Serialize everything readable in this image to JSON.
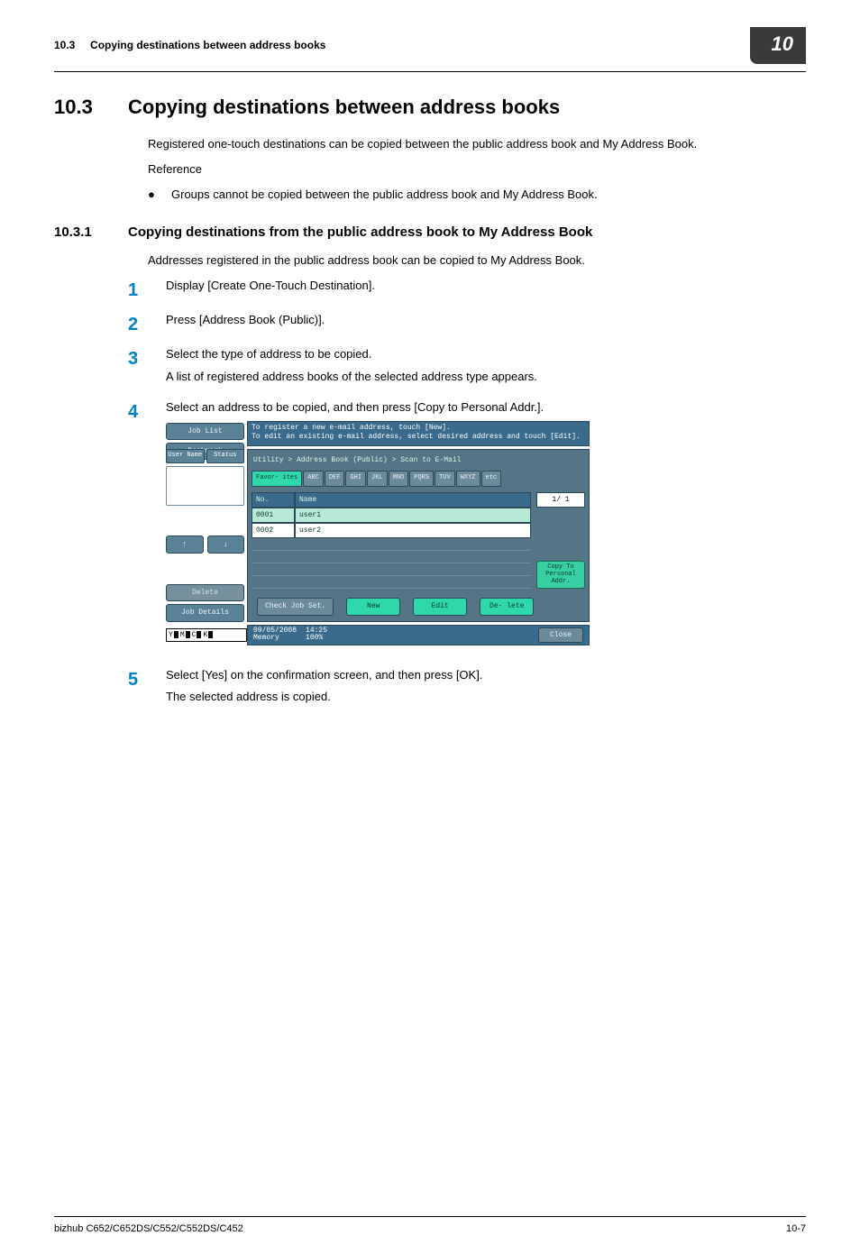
{
  "header": {
    "section_ref": "10.3",
    "running_title": "Copying destinations between address books",
    "chapter_badge": "10"
  },
  "section": {
    "number": "10.3",
    "title": "Copying destinations between address books",
    "intro": "Registered one-touch destinations can be copied between the public address book and My Address Book.",
    "ref_label": "Reference",
    "bullet": "Groups cannot be copied between the public address book and My Address Book."
  },
  "subsection": {
    "number": "10.3.1",
    "title": "Copying destinations from the public address book to My Address Book",
    "intro": "Addresses registered in the public address book can be copied to My Address Book."
  },
  "steps": [
    {
      "n": "1",
      "text": "Display [Create One-Touch Destination]."
    },
    {
      "n": "2",
      "text": "Press [Address Book (Public)]."
    },
    {
      "n": "3",
      "text": "Select the type of address to be copied.",
      "sub": "A list of registered address books of the selected address type appears."
    },
    {
      "n": "4",
      "text": "Select an address to be copied, and then press [Copy to Personal Addr.]."
    },
    {
      "n": "5",
      "text": "Select [Yes] on the confirmation screen, and then press [OK].",
      "sub": "The selected address is copied."
    }
  ],
  "panel": {
    "msg1": "To register a new e-mail address, touch [New].",
    "msg2": "To edit an existing e-mail address, select desired address and touch [Edit].",
    "btn_joblist": "Job List",
    "btn_bookmark": "Bookmark",
    "btn_username": "User Name",
    "btn_status": "Status",
    "btn_delete": "Delete",
    "btn_jobdetails": "Job Details",
    "breadcrumb": "Utility > Address Book (Public) > Scan to E-Mail",
    "tabs": [
      "Favor- ites",
      "ABC",
      "DEF",
      "GHI",
      "JKL",
      "MNO",
      "PQRS",
      "TUV",
      "WXYZ",
      "etc"
    ],
    "col_no": "No.",
    "col_name": "Name",
    "rows": [
      {
        "no": "0001",
        "name": "user1"
      },
      {
        "no": "0002",
        "name": "user2"
      }
    ],
    "page_ind": "1/  1",
    "copy_btn": "Copy To Personal Addr.",
    "act_check": "Check Job Set.",
    "act_new": "New",
    "act_edit": "Edit",
    "act_delete": "De- lete",
    "footer_date": "09/05/2008",
    "footer_mem_label": "Memory",
    "footer_time": "14:25",
    "footer_mem": "100%",
    "close": "Close",
    "supplies": [
      "Y",
      "M",
      "C",
      "K"
    ],
    "arrow_up": "↑",
    "arrow_down": "↓"
  },
  "footer": {
    "model": "bizhub C652/C652DS/C552/C552DS/C452",
    "page": "10-7"
  }
}
